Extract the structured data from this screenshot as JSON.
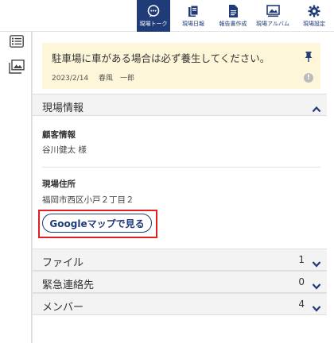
{
  "nav": {
    "items": [
      {
        "label": "現場トーク",
        "icon": "chat-icon",
        "active": true
      },
      {
        "label": "現場日報",
        "icon": "daily-report-icon",
        "active": false
      },
      {
        "label": "報告書作成",
        "icon": "report-document-icon",
        "active": false
      },
      {
        "label": "現場アルバム",
        "icon": "album-icon",
        "active": false
      },
      {
        "label": "現場設定",
        "icon": "settings-gear-icon",
        "active": false
      }
    ]
  },
  "rail": {
    "icons": [
      "list-icon",
      "gallery-icon"
    ]
  },
  "notice": {
    "text": "駐車場に車がある場合は必ず養生してください。",
    "date": "2023/2/14",
    "author": "春風　一郎"
  },
  "site_info": {
    "title": "現場情報",
    "customer_label": "顧客情報",
    "customer_value": "谷川健太 様",
    "address_label": "現場住所",
    "address_value": "福岡市西区小戸２丁目２",
    "map_button": "Googleマップで見る"
  },
  "sections": [
    {
      "title": "ファイル",
      "count": "1"
    },
    {
      "title": "緊急連絡先",
      "count": "0"
    },
    {
      "title": "メンバー",
      "count": "4"
    }
  ],
  "colors": {
    "accent": "#1f3b78",
    "notice_bg": "#fdf6d8",
    "highlight": "#e02020"
  }
}
